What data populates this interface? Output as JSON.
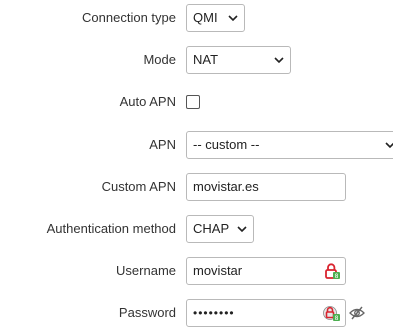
{
  "fields": {
    "connection_type": {
      "label": "Connection type",
      "value": "QMI"
    },
    "mode": {
      "label": "Mode",
      "value": "NAT"
    },
    "auto_apn": {
      "label": "Auto APN",
      "checked": false
    },
    "apn": {
      "label": "APN",
      "value": "-- custom --"
    },
    "custom_apn": {
      "label": "Custom APN",
      "value": "movistar.es"
    },
    "auth_method": {
      "label": "Authentication method",
      "value": "CHAP"
    },
    "username": {
      "label": "Username",
      "value": "movistar"
    },
    "password": {
      "label": "Password",
      "value": "••••••••"
    }
  },
  "icons": {
    "username_field": "password-manager-lock-icon",
    "password_field": "password-manager-lock-icon",
    "password_toggle": "eye-slash-icon"
  },
  "colors": {
    "text": "#333333",
    "border": "#b9b9b9",
    "lock_red": "#d9232e",
    "lock_green": "#4caf50"
  }
}
